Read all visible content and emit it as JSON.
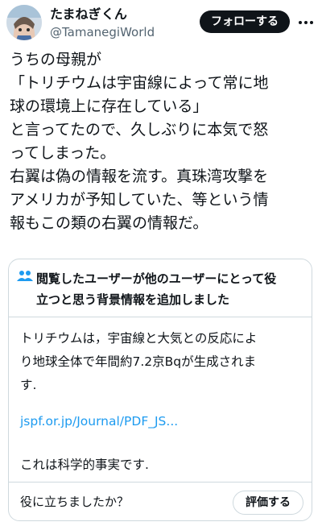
{
  "author": {
    "display_name": "たまねぎくん",
    "handle": "@TamanegiWorld",
    "avatar_icon": "anime-character-avatar"
  },
  "header": {
    "follow_label": "フォローする",
    "more_icon": "more-dots-icon"
  },
  "tweet": {
    "lines": [
      "うちの母親が",
      "「トリチウムは宇宙線によって常に地",
      "球の環境上に存在している」",
      "と言ってたので、久しぶりに本気で怒",
      "ってしまった。",
      "右翼は偽の情報を流す。真珠湾攻撃を",
      "アメリカが予知していた、等という情",
      "報もこの類の右翼の情報だ。"
    ]
  },
  "community_note": {
    "icon": "people-icon",
    "title_lines": [
      "閲覧したユーザーが他のユーザーにとって役",
      "立つと思う背景情報を追加しました"
    ],
    "body_lines": [
      "トリチウムは，宇宙線と大気との反応によ",
      "り地球全体で年間約7.2京Bqが生成されま",
      "す."
    ],
    "link_text": "jspf.or.jp/Journal/PDF_JS...",
    "fact_text": "これは科学的事実です.",
    "helpful_question": "役に立ちましたか？",
    "rate_label": "評価する"
  },
  "colors": {
    "text": "#0f1419",
    "secondary": "#536471",
    "link": "#1d9bf0",
    "border": "#cfd9de",
    "note_icon": "#1d9bf0"
  }
}
